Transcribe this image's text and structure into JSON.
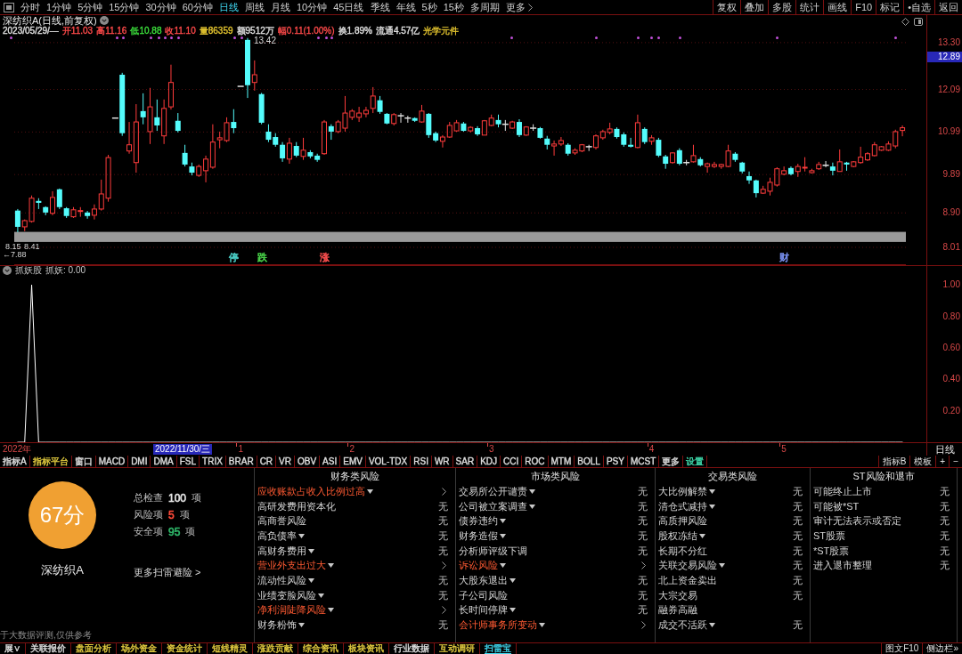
{
  "toolbar": {
    "periods": [
      {
        "label": "分时",
        "selected": false
      },
      {
        "label": "1分钟",
        "selected": false
      },
      {
        "label": "5分钟",
        "selected": false
      },
      {
        "label": "15分钟",
        "selected": false
      },
      {
        "label": "30分钟",
        "selected": false
      },
      {
        "label": "60分钟",
        "selected": false
      },
      {
        "label": "日线",
        "selected": true
      },
      {
        "label": "周线",
        "selected": false
      },
      {
        "label": "月线",
        "selected": false
      },
      {
        "label": "10分钟",
        "selected": false
      },
      {
        "label": "45日线",
        "selected": false
      },
      {
        "label": "季线",
        "selected": false
      },
      {
        "label": "年线",
        "selected": false
      },
      {
        "label": "5秒",
        "selected": false
      },
      {
        "label": "15秒",
        "selected": false
      },
      {
        "label": "多周期",
        "selected": false
      }
    ],
    "more": "更多",
    "buttons": [
      "复权",
      "叠加",
      "多股",
      "统计",
      "画线",
      "F10",
      "标记",
      "•自选",
      "返回"
    ]
  },
  "price_pane": {
    "title": "深纺织A(日线,前复权)",
    "quote": [
      {
        "text": "2023/05/29/—",
        "color": "#e0e0e0"
      },
      {
        "text": "开11.03",
        "color": "#ff4a4a"
      },
      {
        "text": "高11.16",
        "color": "#ff4a4a"
      },
      {
        "text": "低10.88",
        "color": "#3ce03c"
      },
      {
        "text": "收11.10",
        "color": "#ff4a4a"
      },
      {
        "text": "量86359",
        "color": "#e8c830"
      },
      {
        "text": "额9512万",
        "color": "#e0e0e0"
      },
      {
        "text": "幅0.11(1.00%)",
        "color": "#ff4a4a"
      },
      {
        "text": "换1.89%",
        "color": "#e0e0e0"
      },
      {
        "text": "流通4.57亿",
        "color": "#e0e0e0"
      },
      {
        "text": "光学元件",
        "color": "#e8c830"
      }
    ],
    "cursor_price": "12.89",
    "events": [
      {
        "label": "停",
        "color": "#48c8c0"
      },
      {
        "label": "跌",
        "color": "#48d048"
      },
      {
        "label": "涨",
        "color": "#ff5050"
      },
      {
        "label": "财",
        "color": "#7890f0"
      }
    ],
    "chart_data": {
      "type": "candlestick",
      "ohlc": [
        [
          8.96,
          9.0,
          8.4,
          8.54
        ],
        [
          8.54,
          8.73,
          8.43,
          8.7
        ],
        [
          8.68,
          9.35,
          8.65,
          9.28
        ],
        [
          9.21,
          9.28,
          9.0,
          9.16
        ],
        [
          9.05,
          9.07,
          8.84,
          8.91
        ],
        [
          8.89,
          9.46,
          8.84,
          9.3
        ],
        [
          9.51,
          9.53,
          9.0,
          9.05
        ],
        [
          9.02,
          9.05,
          8.77,
          8.82
        ],
        [
          8.8,
          9.05,
          8.77,
          8.98
        ],
        [
          8.94,
          9.05,
          8.8,
          8.96
        ],
        [
          8.91,
          8.95,
          8.75,
          8.82
        ],
        [
          8.84,
          9.12,
          8.73,
          9.0
        ],
        [
          9.0,
          9.76,
          8.96,
          9.39
        ],
        [
          9.28,
          10.4,
          9.19,
          10.33
        ],
        [
          11.35,
          11.35,
          11.35,
          11.35
        ],
        [
          12.47,
          12.52,
          10.89,
          10.96
        ],
        [
          10.5,
          11.25,
          10.43,
          10.66
        ],
        [
          10.2,
          11.71,
          9.94,
          11.25
        ],
        [
          11.53,
          11.99,
          11.19,
          11.37
        ],
        [
          11.0,
          12.13,
          10.68,
          11.64
        ],
        [
          11.37,
          11.83,
          11.02,
          11.16
        ],
        [
          10.89,
          11.83,
          10.68,
          11.6
        ],
        [
          11.64,
          12.73,
          11.57,
          12.27
        ],
        [
          11.28,
          11.48,
          10.98,
          11.02
        ],
        [
          10.45,
          10.66,
          10.1,
          10.15
        ],
        [
          10.1,
          10.2,
          9.87,
          9.94
        ],
        [
          9.87,
          10.15,
          9.83,
          10.1
        ],
        [
          9.99,
          10.38,
          9.69,
          10.29
        ],
        [
          10.08,
          11.19,
          10.04,
          10.73
        ],
        [
          10.79,
          11.0,
          10.57,
          10.84
        ],
        [
          10.77,
          11.37,
          10.73,
          11.23
        ],
        [
          11.25,
          11.58,
          10.96,
          11.09
        ],
        [
          12.17,
          12.17,
          12.17,
          12.17
        ],
        [
          13.37,
          13.42,
          11.87,
          12.2
        ],
        [
          12.27,
          12.84,
          12.06,
          12.47
        ],
        [
          11.97,
          12.0,
          11.19,
          11.23
        ],
        [
          11.0,
          11.19,
          10.73,
          10.79
        ],
        [
          10.86,
          10.96,
          10.61,
          10.66
        ],
        [
          10.66,
          10.73,
          10.22,
          10.31
        ],
        [
          10.29,
          10.84,
          10.17,
          10.7
        ],
        [
          10.63,
          10.73,
          10.34,
          10.38
        ],
        [
          10.36,
          10.84,
          10.27,
          10.52
        ],
        [
          10.47,
          10.52,
          10.31,
          10.36
        ],
        [
          10.38,
          10.43,
          10.22,
          10.27
        ],
        [
          10.43,
          11.3,
          10.4,
          11.25
        ],
        [
          11.14,
          11.19,
          10.79,
          11.0
        ],
        [
          11.0,
          11.3,
          10.96,
          11.25
        ],
        [
          11.09,
          11.92,
          11.0,
          11.48
        ],
        [
          11.37,
          11.58,
          11.3,
          11.53
        ],
        [
          11.37,
          11.64,
          11.25,
          11.48
        ],
        [
          11.46,
          11.64,
          11.37,
          11.55
        ],
        [
          11.6,
          12.15,
          11.48,
          11.92
        ],
        [
          11.81,
          11.92,
          11.46,
          11.51
        ],
        [
          11.46,
          11.48,
          11.19,
          11.21
        ],
        [
          11.21,
          11.48,
          11.16,
          11.44
        ],
        [
          11.41,
          11.48,
          11.23,
          11.41
        ],
        [
          11.35,
          11.41,
          11.23,
          11.35
        ],
        [
          11.35,
          11.37,
          11.25,
          11.28
        ],
        [
          11.25,
          11.69,
          11.23,
          11.53
        ],
        [
          11.46,
          11.48,
          10.84,
          10.91
        ],
        [
          10.96,
          11.0,
          10.73,
          10.77
        ],
        [
          10.75,
          10.91,
          10.59,
          10.86
        ],
        [
          10.86,
          11.25,
          10.84,
          11.16
        ],
        [
          11.02,
          11.3,
          11.0,
          11.23
        ],
        [
          11.21,
          11.25,
          11.0,
          11.02
        ],
        [
          11.02,
          11.14,
          10.98,
          11.11
        ],
        [
          11.09,
          11.14,
          10.89,
          10.93
        ],
        [
          10.91,
          11.3,
          10.91,
          11.28
        ],
        [
          11.16,
          11.44,
          11.14,
          11.35
        ],
        [
          11.3,
          11.44,
          11.11,
          11.19
        ],
        [
          11.19,
          11.3,
          11.02,
          11.19
        ],
        [
          11.09,
          11.28,
          11.07,
          11.25
        ],
        [
          11.25,
          11.32,
          10.86,
          10.91
        ],
        [
          10.91,
          11.14,
          10.89,
          11.12
        ],
        [
          11.09,
          11.19,
          11.02,
          11.09
        ],
        [
          11.09,
          11.12,
          10.82,
          10.84
        ],
        [
          10.82,
          10.89,
          10.54,
          10.66
        ],
        [
          10.63,
          10.77,
          10.38,
          10.68
        ],
        [
          10.68,
          10.86,
          10.63,
          10.77
        ],
        [
          10.66,
          10.7,
          10.38,
          10.43
        ],
        [
          10.45,
          10.57,
          10.4,
          10.52
        ],
        [
          10.5,
          10.68,
          10.47,
          10.66
        ],
        [
          10.61,
          10.66,
          10.5,
          10.61
        ],
        [
          10.59,
          10.93,
          10.54,
          10.89
        ],
        [
          10.84,
          11.05,
          10.79,
          11.0
        ],
        [
          10.98,
          11.23,
          10.93,
          11.07
        ],
        [
          11.07,
          11.11,
          10.82,
          10.86
        ],
        [
          10.93,
          10.98,
          10.61,
          10.66
        ],
        [
          10.66,
          10.84,
          10.59,
          10.61
        ],
        [
          10.59,
          11.44,
          10.57,
          11.23
        ],
        [
          11.07,
          11.11,
          10.68,
          10.73
        ],
        [
          10.75,
          10.91,
          10.66,
          10.84
        ],
        [
          10.79,
          10.84,
          10.34,
          10.38
        ],
        [
          10.36,
          10.4,
          10.04,
          10.17
        ],
        [
          10.2,
          10.47,
          10.17,
          10.45
        ],
        [
          10.52,
          10.57,
          10.13,
          10.17
        ],
        [
          10.2,
          10.27,
          10.13,
          10.2
        ],
        [
          10.22,
          10.66,
          10.2,
          10.38
        ],
        [
          10.29,
          10.34,
          10.1,
          10.13
        ],
        [
          10.1,
          10.2,
          9.94,
          10.17
        ],
        [
          10.1,
          10.22,
          10.06,
          10.15
        ],
        [
          10.1,
          10.17,
          10.04,
          10.15
        ],
        [
          10.1,
          10.66,
          10.08,
          10.5
        ],
        [
          10.43,
          10.47,
          10.22,
          10.27
        ],
        [
          10.2,
          10.22,
          9.92,
          9.97
        ],
        [
          9.85,
          9.97,
          9.65,
          9.74
        ],
        [
          9.74,
          9.76,
          9.3,
          9.41
        ],
        [
          9.41,
          9.6,
          9.39,
          9.51
        ],
        [
          9.46,
          9.81,
          9.35,
          9.69
        ],
        [
          9.62,
          10.08,
          9.58,
          10.04
        ],
        [
          9.9,
          10.1,
          9.87,
          9.99
        ],
        [
          10.06,
          10.1,
          9.87,
          9.9
        ],
        [
          9.97,
          10.17,
          9.83,
          10.1
        ],
        [
          10.06,
          10.34,
          9.97,
          10.08
        ],
        [
          9.94,
          10.04,
          9.92,
          9.99
        ],
        [
          10.04,
          10.22,
          10.01,
          10.15
        ],
        [
          10.13,
          10.24,
          10.08,
          10.13
        ],
        [
          10.1,
          10.2,
          9.87,
          9.99
        ],
        [
          9.97,
          10.54,
          9.97,
          10.22
        ],
        [
          10.2,
          10.22,
          9.99,
          10.15
        ],
        [
          10.1,
          10.24,
          10.08,
          10.22
        ],
        [
          10.2,
          10.61,
          10.17,
          10.34
        ],
        [
          10.27,
          10.47,
          10.24,
          10.43
        ],
        [
          10.38,
          10.73,
          10.36,
          10.66
        ],
        [
          10.52,
          10.63,
          10.5,
          10.61
        ],
        [
          10.52,
          10.75,
          10.5,
          10.68
        ],
        [
          10.63,
          11.05,
          10.57,
          11.0
        ],
        [
          11.03,
          11.16,
          10.88,
          11.1
        ]
      ],
      "yticks": [
        {
          "value": 13.3,
          "label": "13.30"
        },
        {
          "value": 12.09,
          "label": "12.09"
        },
        {
          "value": 10.99,
          "label": "10.99"
        },
        {
          "value": 9.89,
          "label": "9.89"
        },
        {
          "value": 8.9,
          "label": "8.90"
        },
        {
          "value": 8.01,
          "label": "8.01"
        }
      ],
      "ylim": [
        7.55,
        14.01
      ],
      "grid": true,
      "bands": [
        {
          "axis": "y",
          "from": 8.15,
          "to": 8.41,
          "color": "#9a9a9a"
        }
      ],
      "annotations": [
        "13.42",
        "8.15",
        "8.41",
        "←7.88"
      ]
    }
  },
  "indicator_pane": {
    "name": "抓妖股",
    "legend": "抓妖: 0.00",
    "year_label": "2022年",
    "cursor_date": "2022/11/30/三",
    "period_label": "日线",
    "chart_data": {
      "type": "line",
      "color": "#ffffff",
      "categories": [
        null,
        null,
        null,
        null,
        null,
        null,
        null,
        null,
        null,
        null,
        null,
        null,
        null,
        null,
        null,
        null,
        null,
        null,
        null,
        null,
        null,
        null,
        null,
        null,
        null,
        null,
        null,
        null,
        null,
        null,
        null,
        null,
        "1",
        null,
        null,
        null,
        null,
        null,
        null,
        null,
        null,
        null,
        null,
        null,
        null,
        null,
        null,
        null,
        "2",
        null,
        null,
        null,
        null,
        null,
        null,
        null,
        null,
        null,
        null,
        null,
        null,
        null,
        null,
        null,
        null,
        null,
        null,
        null,
        "3",
        null,
        null,
        null,
        null,
        null,
        null,
        null,
        null,
        null,
        null,
        null,
        null,
        null,
        null,
        null,
        null,
        null,
        null,
        null,
        null,
        null,
        null,
        "4",
        null,
        null,
        null,
        null,
        null,
        null,
        null,
        null,
        null,
        null,
        null,
        null,
        null,
        null,
        null,
        null,
        null,
        null,
        "5",
        null,
        null,
        null,
        null,
        null,
        null,
        null,
        null,
        null,
        null,
        null,
        null,
        null,
        null,
        null,
        null,
        null
      ],
      "values": [
        0,
        0,
        1,
        0,
        0,
        0,
        0,
        0,
        0,
        0,
        0,
        0,
        0,
        0,
        0,
        0,
        0,
        0,
        0,
        0,
        0,
        0,
        0,
        0,
        0,
        0,
        0,
        0,
        0,
        0,
        0,
        0,
        0,
        0,
        0,
        0,
        0,
        0,
        0,
        0,
        0,
        0,
        0,
        0,
        0,
        0,
        0,
        0,
        0,
        0,
        0,
        0,
        0,
        0,
        0,
        0,
        0,
        0,
        0,
        0,
        0,
        0,
        0,
        0,
        0,
        0,
        0,
        0,
        0,
        0,
        0,
        0,
        0,
        0,
        0,
        0,
        0,
        0,
        0,
        0,
        0,
        0,
        0,
        0,
        0,
        0,
        0,
        0,
        0,
        0,
        0,
        0,
        0,
        0,
        0,
        0,
        0,
        0,
        0,
        0,
        0,
        0,
        0,
        0,
        0,
        0,
        0,
        0,
        0,
        0,
        0,
        0,
        0,
        0,
        0,
        0,
        0,
        0,
        0,
        0,
        0,
        0,
        0,
        0,
        0,
        0,
        0,
        0
      ],
      "yticks": [
        {
          "value": 1,
          "label": "1.00"
        },
        {
          "value": 0.8,
          "label": "0.80"
        },
        {
          "value": 0.6,
          "label": "0.60"
        },
        {
          "value": 0.4,
          "label": "0.40"
        },
        {
          "value": 0.2,
          "label": "0.20"
        }
      ],
      "ylim": [
        0,
        1.12
      ]
    }
  },
  "indicator_tabs": {
    "left": [
      {
        "label": "指标A",
        "color": "#e0e0e0"
      },
      {
        "label": "指标平台",
        "color": "#e8d040"
      },
      {
        "label": "窗口",
        "color": "#e0e0e0"
      },
      {
        "label": "MACD",
        "color": "#e0e0e0"
      },
      {
        "label": "DMI",
        "color": "#e0e0e0"
      },
      {
        "label": "DMA",
        "color": "#e0e0e0"
      },
      {
        "label": "FSL",
        "color": "#e0e0e0"
      },
      {
        "label": "TRIX",
        "color": "#e0e0e0"
      },
      {
        "label": "BRAR",
        "color": "#e0e0e0"
      },
      {
        "label": "CR",
        "color": "#e0e0e0"
      },
      {
        "label": "VR",
        "color": "#e0e0e0"
      },
      {
        "label": "OBV",
        "color": "#e0e0e0"
      },
      {
        "label": "ASI",
        "color": "#e0e0e0"
      },
      {
        "label": "EMV",
        "color": "#e0e0e0"
      },
      {
        "label": "VOL-TDX",
        "color": "#e0e0e0"
      },
      {
        "label": "RSI",
        "color": "#e0e0e0"
      },
      {
        "label": "WR",
        "color": "#e0e0e0"
      },
      {
        "label": "SAR",
        "color": "#e0e0e0"
      },
      {
        "label": "KDJ",
        "color": "#e0e0e0"
      },
      {
        "label": "CCI",
        "color": "#e0e0e0"
      },
      {
        "label": "ROC",
        "color": "#e0e0e0"
      },
      {
        "label": "MTM",
        "color": "#e0e0e0"
      },
      {
        "label": "BOLL",
        "color": "#e0e0e0"
      },
      {
        "label": "PSY",
        "color": "#e0e0e0"
      },
      {
        "label": "MCST",
        "color": "#e0e0e0"
      },
      {
        "label": "更多",
        "color": "#e0e0e0"
      },
      {
        "label": "设置",
        "color": "#40e0b0"
      }
    ],
    "right": [
      "指标B",
      "模板",
      "+",
      "−"
    ]
  },
  "risk_scan": {
    "score": "67分",
    "stock": "深纺织A",
    "stats": [
      {
        "label": "总检查",
        "value": "100",
        "unit": "项",
        "color": "#e6e6e6"
      },
      {
        "label": "风险项",
        "value": "5",
        "unit": "项",
        "color": "#ff4a3a"
      },
      {
        "label": "安全项",
        "value": "95",
        "unit": "项",
        "color": "#2fb86a"
      }
    ],
    "more": "更多扫雷避险 >",
    "disclaimer": "于大数据评测,仅供参考",
    "categories": [
      {
        "title": "财务类风险",
        "items": [
          {
            "label": "应收账款占收入比例过高",
            "dropdown": true,
            "risk": true
          },
          {
            "label": "高研发费用资本化",
            "dropdown": false,
            "risk": false,
            "value": "无"
          },
          {
            "label": "高商誉风险",
            "dropdown": false,
            "risk": false,
            "value": "无"
          },
          {
            "label": "高负债率",
            "dropdown": true,
            "risk": false,
            "value": "无"
          },
          {
            "label": "高财务费用",
            "dropdown": true,
            "risk": false,
            "value": "无"
          },
          {
            "label": "营业外支出过大",
            "dropdown": true,
            "risk": true
          },
          {
            "label": "流动性风险",
            "dropdown": true,
            "risk": false,
            "value": "无"
          },
          {
            "label": "业绩变脸风险",
            "dropdown": true,
            "risk": false,
            "value": "无"
          },
          {
            "label": "净利润陡降风险",
            "dropdown": true,
            "risk": true
          },
          {
            "label": "财务粉饰",
            "dropdown": true,
            "risk": false,
            "value": "无"
          }
        ]
      },
      {
        "title": "市场类风险",
        "items": [
          {
            "label": "交易所公开谴责",
            "dropdown": true,
            "risk": false,
            "value": "无"
          },
          {
            "label": "公司被立案调查",
            "dropdown": true,
            "risk": false,
            "value": "无"
          },
          {
            "label": "债券违约",
            "dropdown": true,
            "risk": false,
            "value": "无"
          },
          {
            "label": "财务造假",
            "dropdown": true,
            "risk": false,
            "value": "无"
          },
          {
            "label": "分析师评级下调",
            "dropdown": false,
            "risk": false,
            "value": "无"
          },
          {
            "label": "诉讼风险",
            "dropdown": true,
            "risk": true
          },
          {
            "label": "大股东退出",
            "dropdown": true,
            "risk": false,
            "value": "无"
          },
          {
            "label": "子公司风险",
            "dropdown": false,
            "risk": false,
            "value": "无"
          },
          {
            "label": "长时间停牌",
            "dropdown": true,
            "risk": false,
            "value": "无"
          },
          {
            "label": "会计师事务所变动",
            "dropdown": true,
            "risk": true
          }
        ]
      },
      {
        "title": "交易类风险",
        "items": [
          {
            "label": "大比例解禁",
            "dropdown": true,
            "risk": false,
            "value": "无"
          },
          {
            "label": "清仓式减持",
            "dropdown": true,
            "risk": false,
            "value": "无"
          },
          {
            "label": "高质押风险",
            "dropdown": false,
            "risk": false,
            "value": "无"
          },
          {
            "label": "股权冻结",
            "dropdown": true,
            "risk": false,
            "value": "无"
          },
          {
            "label": "长期不分红",
            "dropdown": false,
            "risk": false,
            "value": "无"
          },
          {
            "label": "关联交易风险",
            "dropdown": true,
            "risk": false,
            "value": "无"
          },
          {
            "label": "北上资金卖出",
            "dropdown": false,
            "risk": false,
            "value": "无"
          },
          {
            "label": "大宗交易",
            "dropdown": false,
            "risk": false,
            "value": "无"
          },
          {
            "label": "融券高融",
            "dropdown": false,
            "risk": false
          },
          {
            "label": "成交不活跃",
            "dropdown": true,
            "risk": false,
            "value": "无"
          }
        ]
      },
      {
        "title": "ST风险和退市",
        "items": [
          {
            "label": "可能终止上市",
            "dropdown": false,
            "risk": false,
            "value": "无"
          },
          {
            "label": "可能被*ST",
            "dropdown": false,
            "risk": false,
            "value": "无"
          },
          {
            "label": "审计无法表示或否定",
            "dropdown": false,
            "risk": false,
            "value": "无"
          },
          {
            "label": "ST股票",
            "dropdown": false,
            "risk": false,
            "value": "无"
          },
          {
            "label": "*ST股票",
            "dropdown": false,
            "risk": false,
            "value": "无"
          },
          {
            "label": "进入退市整理",
            "dropdown": false,
            "risk": false,
            "value": "无"
          }
        ]
      }
    ]
  },
  "bottom_tabs": {
    "left": [
      {
        "label": "展∨",
        "color": "#e0e0e0",
        "selected": false
      },
      {
        "label": "关联报价",
        "color": "#e0e0e0",
        "selected": false
      },
      {
        "label": "盘面分析",
        "color": "#e8d040",
        "selected": false
      },
      {
        "label": "场外资金",
        "color": "#e8d040",
        "selected": false
      },
      {
        "label": "资金统计",
        "color": "#e8d040",
        "selected": false
      },
      {
        "label": "短线精灵",
        "color": "#e8d040",
        "selected": false
      },
      {
        "label": "涨跌贡献",
        "color": "#e8d040",
        "selected": false
      },
      {
        "label": "综合资讯",
        "color": "#e8d040",
        "selected": false
      },
      {
        "label": "板块资讯",
        "color": "#e8d040",
        "selected": false
      },
      {
        "label": "行业数据",
        "color": "#e0e0e0",
        "selected": false
      },
      {
        "label": "互动调研",
        "color": "#e8d040",
        "selected": false
      },
      {
        "label": "扫雷宝",
        "color": "#40d8f0",
        "selected": true
      }
    ],
    "right": [
      "图文F10",
      "侧边栏»"
    ]
  }
}
